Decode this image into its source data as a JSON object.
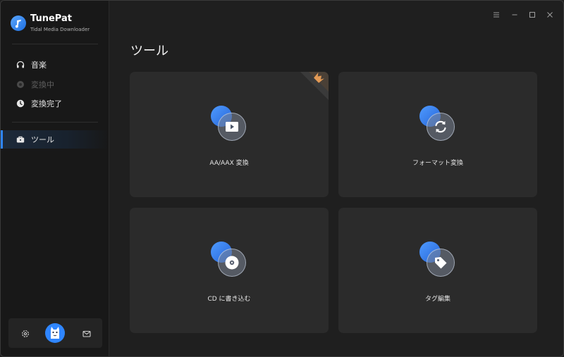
{
  "app": {
    "name": "TunePat",
    "subtitle": "Tidal Media Downloader"
  },
  "sidebar": {
    "items": [
      {
        "label": "音楽",
        "icon": "headphones-icon",
        "state": "normal"
      },
      {
        "label": "変換中",
        "icon": "converting-icon",
        "state": "disabled"
      },
      {
        "label": "変換完了",
        "icon": "clock-icon",
        "state": "normal"
      },
      {
        "label": "ツール",
        "icon": "toolbox-icon",
        "state": "active"
      }
    ],
    "bottom": {
      "settings_icon": "gear-icon",
      "avatar_icon": "avatar-icon",
      "mail_icon": "mail-icon"
    }
  },
  "titlebar": {
    "menu_icon": "menu-icon",
    "minimize_icon": "minimize-icon",
    "maximize_icon": "maximize-icon",
    "close_icon": "close-icon"
  },
  "main": {
    "title": "ツール",
    "tools": [
      {
        "label": "AA/AAX 変換",
        "icon": "video-play-icon",
        "badge": "premium-crown-icon"
      },
      {
        "label": "フォーマット変換",
        "icon": "convert-arrows-icon"
      },
      {
        "label": "CD に書き込む",
        "icon": "disc-icon"
      },
      {
        "label": "タグ編集",
        "icon": "tag-icon"
      }
    ]
  },
  "colors": {
    "accent": "#2f86ff",
    "background": "#1f1f1f",
    "sidebar": "#181818",
    "card": "#2b2b2b",
    "badge": "#e39a55"
  }
}
